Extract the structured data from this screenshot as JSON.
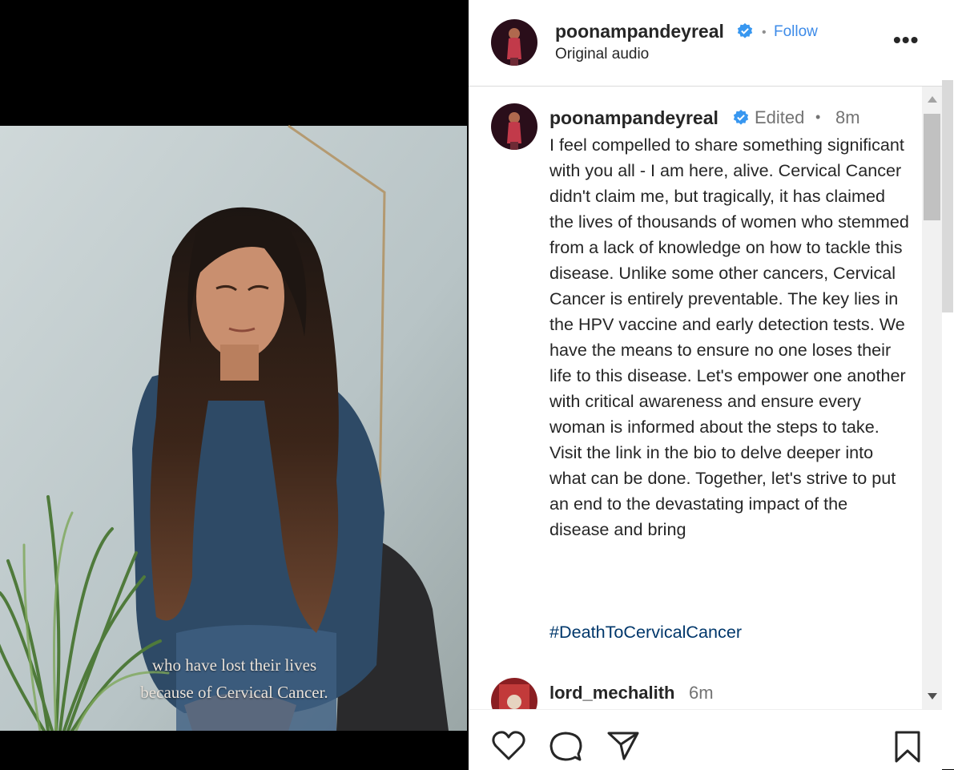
{
  "video": {
    "caption_line1": "who have lost their lives",
    "caption_line2": "because of Cervical Cancer."
  },
  "post_header": {
    "username": "poonampandeyreal",
    "separator": "•",
    "follow_label": "Follow",
    "audio_label": "Original audio",
    "more_icon": "more-icon"
  },
  "caption_post": {
    "username": "poonampandeyreal",
    "edited_label": "Edited",
    "separator": "•",
    "time": "8m",
    "text": "I feel compelled to share something significant with you all - I am here, alive. Cervical Cancer didn't claim me, but tragically, it has claimed the lives of thousands of women who stemmed from a lack of knowledge on how to tackle this disease. Unlike some other cancers, Cervical Cancer is entirely preventable. The key lies in the HPV vaccine and early detection tests. We have the means to ensure no one loses their life to this disease. Let's empower one another with critical awareness and ensure every woman is informed about the steps to take. Visit the link in the bio to delve deeper into what can be done. Together, let's strive to put an end to the devastating impact of the disease and bring",
    "hashtag": "#DeathToCervicalCancer"
  },
  "comments": [
    {
      "username": "lord_mechalith",
      "time": "6m"
    }
  ],
  "actions": {
    "icons": [
      "heart-icon",
      "comment-icon",
      "share-icon",
      "bookmark-icon"
    ]
  },
  "colors": {
    "link_blue": "#3d8be8",
    "hashtag": "#00376b",
    "verified": "#3897f0",
    "text": "#262626",
    "muted": "#737373"
  }
}
